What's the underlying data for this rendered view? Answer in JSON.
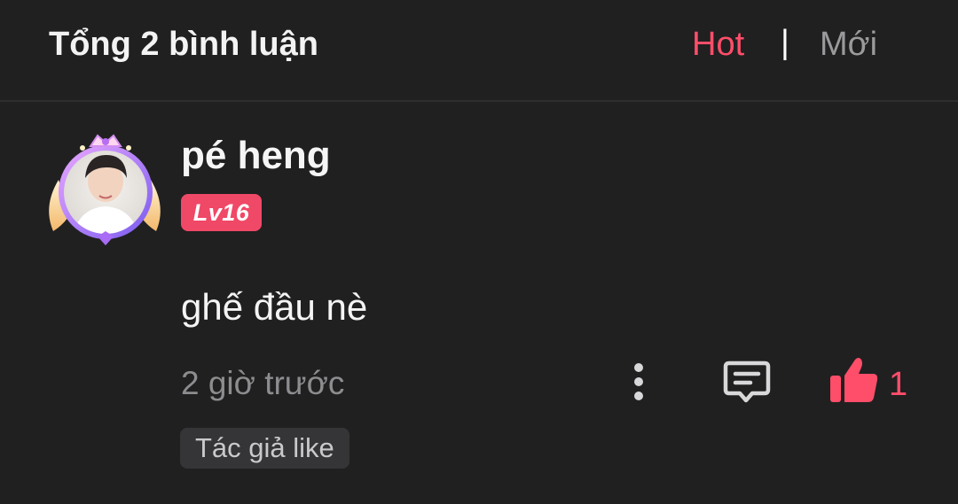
{
  "header": {
    "total_label": "Tổng 2 bình luận",
    "sort_hot": "Hot",
    "sort_separator": "|",
    "sort_new": "Mới"
  },
  "comment": {
    "username": "pé heng",
    "level": "Lv16",
    "text": "ghế đầu nè",
    "time": "2 giờ trước",
    "like_count": "1",
    "author_like_tag": "Tác giả like"
  },
  "colors": {
    "accent": "#ff4e6a",
    "background": "#202021",
    "badge": "#f04867",
    "muted_text": "#8d8d90",
    "tag_bg": "#353537"
  },
  "icons": {
    "more": "vertical-dots-icon",
    "reply": "comment-bubble-icon",
    "like": "thumbs-up-icon"
  }
}
